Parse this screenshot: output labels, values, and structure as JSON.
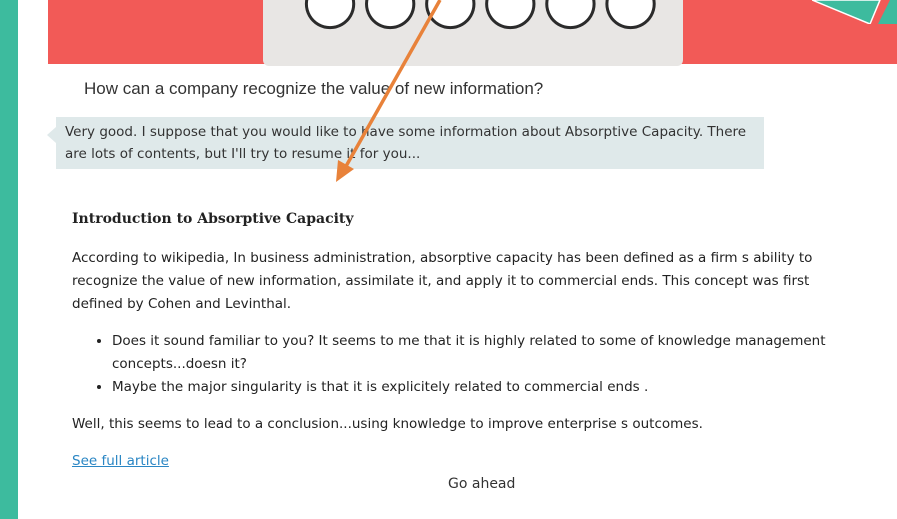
{
  "question": "How can a company recognize the value of new information?",
  "bot_reply": "Very good. I suppose that you would like to have some information about Absorptive Capacity. There are lots of contents, but I'll try to resume it for you...",
  "article": {
    "title": "Introduction to Absorptive Capacity",
    "intro": "According to wikipedia, In business administration, absorptive capacity has been defined as a firm s ability to recognize the value of new information, assimilate it, and apply it to commercial ends. This concept was first defined by Cohen and Levinthal.",
    "bullets": [
      "Does it sound familiar to you? It seems to me that it is highly related to some of knowledge management concepts...doesn it?",
      "Maybe the major singularity is that it is explicitely related to commercial ends ."
    ],
    "conclusion": "Well, this seems to lead to a conclusion...using knowledge to improve enterprise s outcomes.",
    "link_text": "See full article"
  },
  "go_ahead_label": "Go ahead",
  "colors": {
    "background_teal": "#3dbb9e",
    "banner_red": "#f25a57",
    "bubble_bg": "#dfe9ea",
    "link_blue": "#2a86c4",
    "arrow_orange": "#e8823a"
  }
}
